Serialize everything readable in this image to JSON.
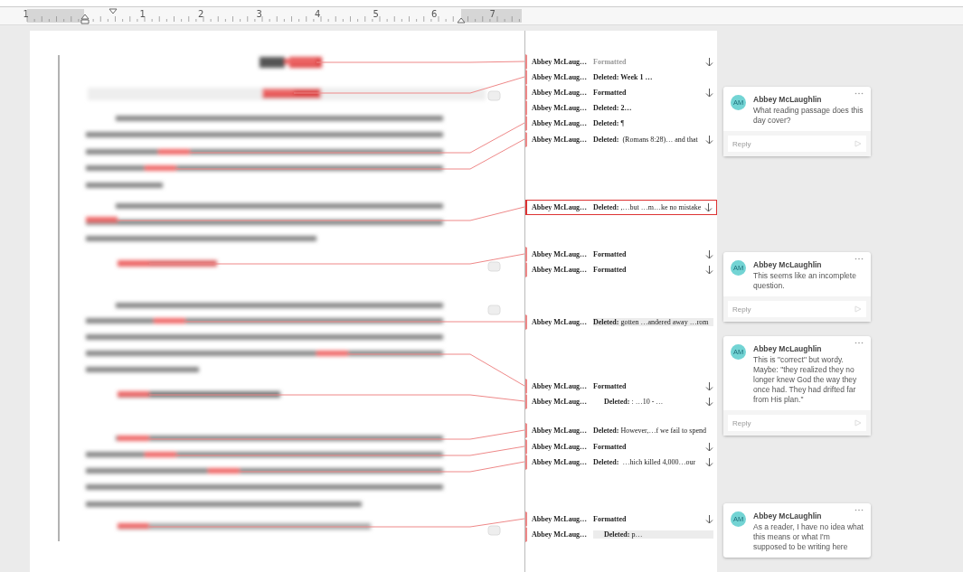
{
  "ruler": {
    "labels": [
      "1",
      "1",
      "2",
      "3",
      "4",
      "5",
      "6",
      "7"
    ]
  },
  "revisions": [
    {
      "author": "Abbey McLaug…",
      "change": "**Formatted**",
      "dimmed": true,
      "arrow": true,
      "selected": false,
      "highlighted": false
    },
    {
      "author": "Abbey McLaug…",
      "change": "**Deleted: Week 1 …**",
      "dimmed": false,
      "arrow": false,
      "selected": false,
      "highlighted": false
    },
    {
      "author": "Abbey McLaug…",
      "change": "**Formatted**",
      "dimmed": false,
      "arrow": true,
      "selected": false,
      "highlighted": false
    },
    {
      "author": "Abbey McLaug…",
      "change": "**Deleted: 2…**",
      "dimmed": false,
      "arrow": false,
      "selected": false,
      "highlighted": false
    },
    {
      "author": "Abbey McLaug…",
      "change": "**Deleted:** ¶",
      "dimmed": false,
      "arrow": false,
      "selected": false,
      "highlighted": false
    },
    {
      "author": "Abbey McLaug…",
      "change": "**Deleted:**  (Romans 8:28)… and that",
      "dimmed": false,
      "arrow": true,
      "selected": false,
      "highlighted": false
    },
    {
      "author": "Abbey McLaug…",
      "change": "**Deleted:** ,…but …m…ke no mistake",
      "dimmed": false,
      "arrow": true,
      "selected": true,
      "highlighted": false
    },
    {
      "author": "Abbey McLaug…",
      "change": "**Formatted**",
      "dimmed": false,
      "arrow": true,
      "selected": false,
      "highlighted": false
    },
    {
      "author": "Abbey McLaug…",
      "change": "**Formatted**",
      "dimmed": false,
      "arrow": true,
      "selected": false,
      "highlighted": false
    },
    {
      "author": "Abbey McLaug…",
      "change": "**Deleted:** gotten …andered away …rom",
      "dimmed": false,
      "arrow": false,
      "selected": false,
      "highlighted": true
    },
    {
      "author": "Abbey McLaug…",
      "change": "**Formatted**",
      "dimmed": false,
      "arrow": true,
      "selected": false,
      "highlighted": false
    },
    {
      "author": "Abbey McLaug…",
      "change": "      **Deleted:** : …10 - …",
      "dimmed": false,
      "arrow": true,
      "selected": false,
      "highlighted": false
    },
    {
      "author": "Abbey McLaug…",
      "change": "**Deleted:** However,…f we fail to spend",
      "dimmed": false,
      "arrow": false,
      "selected": false,
      "highlighted": false
    },
    {
      "author": "Abbey McLaug…",
      "change": "**Formatted**",
      "dimmed": false,
      "arrow": true,
      "selected": false,
      "highlighted": false
    },
    {
      "author": "Abbey McLaug…",
      "change": "**Deleted:**  …hich killed 4,000…our",
      "dimmed": false,
      "arrow": true,
      "selected": false,
      "highlighted": false
    },
    {
      "author": "Abbey McLaug…",
      "change": "**Formatted**",
      "dimmed": false,
      "arrow": true,
      "selected": false,
      "highlighted": false
    },
    {
      "author": "Abbey McLaug…",
      "change": "      **Deleted:** p…",
      "dimmed": false,
      "arrow": false,
      "selected": false,
      "highlighted": true
    }
  ],
  "comments": [
    {
      "initials": "AM",
      "author": "Abbey McLaughlin",
      "text": "What reading passage does this day cover?",
      "reply": {
        "placeholder": "Reply"
      }
    },
    {
      "initials": "AM",
      "author": "Abbey McLaughlin",
      "text": "This seems like an incomplete question.",
      "reply": {
        "placeholder": "Reply"
      }
    },
    {
      "initials": "AM",
      "author": "Abbey McLaughlin",
      "text": "This is \"correct\" but wordy. Maybe: \"they realized they no longer knew God the way they once had. They had drifted far from His plan.\"",
      "reply": {
        "placeholder": "Reply"
      }
    },
    {
      "initials": "AM",
      "author": "Abbey McLaughlin",
      "text": "As a reader, I have no idea what this means or what I'm supposed to be writing here"
    }
  ]
}
